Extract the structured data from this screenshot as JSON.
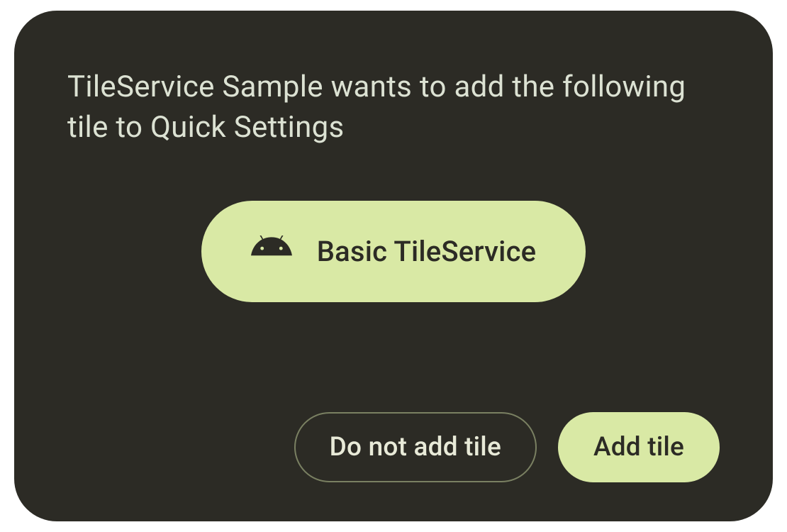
{
  "dialog": {
    "message": "TileService Sample wants to add the following tile to Quick Settings",
    "tile": {
      "label": "Basic TileService",
      "icon": "android-icon"
    },
    "buttons": {
      "cancel": "Do not add tile",
      "confirm": "Add tile"
    }
  },
  "colors": {
    "background": "#2c2b25",
    "accent": "#d9e9a5",
    "text": "#dce2d3",
    "outline": "#7a8062"
  }
}
